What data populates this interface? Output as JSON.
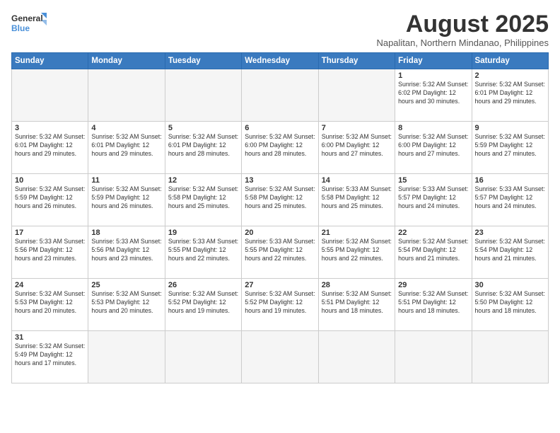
{
  "logo": {
    "line1": "General",
    "line2": "Blue"
  },
  "title": "August 2025",
  "subtitle": "Napalitan, Northern Mindanao, Philippines",
  "weekdays": [
    "Sunday",
    "Monday",
    "Tuesday",
    "Wednesday",
    "Thursday",
    "Friday",
    "Saturday"
  ],
  "weeks": [
    [
      {
        "day": "",
        "info": ""
      },
      {
        "day": "",
        "info": ""
      },
      {
        "day": "",
        "info": ""
      },
      {
        "day": "",
        "info": ""
      },
      {
        "day": "",
        "info": ""
      },
      {
        "day": "1",
        "info": "Sunrise: 5:32 AM\nSunset: 6:02 PM\nDaylight: 12 hours\nand 30 minutes."
      },
      {
        "day": "2",
        "info": "Sunrise: 5:32 AM\nSunset: 6:01 PM\nDaylight: 12 hours\nand 29 minutes."
      }
    ],
    [
      {
        "day": "3",
        "info": "Sunrise: 5:32 AM\nSunset: 6:01 PM\nDaylight: 12 hours\nand 29 minutes."
      },
      {
        "day": "4",
        "info": "Sunrise: 5:32 AM\nSunset: 6:01 PM\nDaylight: 12 hours\nand 29 minutes."
      },
      {
        "day": "5",
        "info": "Sunrise: 5:32 AM\nSunset: 6:01 PM\nDaylight: 12 hours\nand 28 minutes."
      },
      {
        "day": "6",
        "info": "Sunrise: 5:32 AM\nSunset: 6:00 PM\nDaylight: 12 hours\nand 28 minutes."
      },
      {
        "day": "7",
        "info": "Sunrise: 5:32 AM\nSunset: 6:00 PM\nDaylight: 12 hours\nand 27 minutes."
      },
      {
        "day": "8",
        "info": "Sunrise: 5:32 AM\nSunset: 6:00 PM\nDaylight: 12 hours\nand 27 minutes."
      },
      {
        "day": "9",
        "info": "Sunrise: 5:32 AM\nSunset: 5:59 PM\nDaylight: 12 hours\nand 27 minutes."
      }
    ],
    [
      {
        "day": "10",
        "info": "Sunrise: 5:32 AM\nSunset: 5:59 PM\nDaylight: 12 hours\nand 26 minutes."
      },
      {
        "day": "11",
        "info": "Sunrise: 5:32 AM\nSunset: 5:59 PM\nDaylight: 12 hours\nand 26 minutes."
      },
      {
        "day": "12",
        "info": "Sunrise: 5:32 AM\nSunset: 5:58 PM\nDaylight: 12 hours\nand 25 minutes."
      },
      {
        "day": "13",
        "info": "Sunrise: 5:32 AM\nSunset: 5:58 PM\nDaylight: 12 hours\nand 25 minutes."
      },
      {
        "day": "14",
        "info": "Sunrise: 5:33 AM\nSunset: 5:58 PM\nDaylight: 12 hours\nand 25 minutes."
      },
      {
        "day": "15",
        "info": "Sunrise: 5:33 AM\nSunset: 5:57 PM\nDaylight: 12 hours\nand 24 minutes."
      },
      {
        "day": "16",
        "info": "Sunrise: 5:33 AM\nSunset: 5:57 PM\nDaylight: 12 hours\nand 24 minutes."
      }
    ],
    [
      {
        "day": "17",
        "info": "Sunrise: 5:33 AM\nSunset: 5:56 PM\nDaylight: 12 hours\nand 23 minutes."
      },
      {
        "day": "18",
        "info": "Sunrise: 5:33 AM\nSunset: 5:56 PM\nDaylight: 12 hours\nand 23 minutes."
      },
      {
        "day": "19",
        "info": "Sunrise: 5:33 AM\nSunset: 5:55 PM\nDaylight: 12 hours\nand 22 minutes."
      },
      {
        "day": "20",
        "info": "Sunrise: 5:33 AM\nSunset: 5:55 PM\nDaylight: 12 hours\nand 22 minutes."
      },
      {
        "day": "21",
        "info": "Sunrise: 5:32 AM\nSunset: 5:55 PM\nDaylight: 12 hours\nand 22 minutes."
      },
      {
        "day": "22",
        "info": "Sunrise: 5:32 AM\nSunset: 5:54 PM\nDaylight: 12 hours\nand 21 minutes."
      },
      {
        "day": "23",
        "info": "Sunrise: 5:32 AM\nSunset: 5:54 PM\nDaylight: 12 hours\nand 21 minutes."
      }
    ],
    [
      {
        "day": "24",
        "info": "Sunrise: 5:32 AM\nSunset: 5:53 PM\nDaylight: 12 hours\nand 20 minutes."
      },
      {
        "day": "25",
        "info": "Sunrise: 5:32 AM\nSunset: 5:53 PM\nDaylight: 12 hours\nand 20 minutes."
      },
      {
        "day": "26",
        "info": "Sunrise: 5:32 AM\nSunset: 5:52 PM\nDaylight: 12 hours\nand 19 minutes."
      },
      {
        "day": "27",
        "info": "Sunrise: 5:32 AM\nSunset: 5:52 PM\nDaylight: 12 hours\nand 19 minutes."
      },
      {
        "day": "28",
        "info": "Sunrise: 5:32 AM\nSunset: 5:51 PM\nDaylight: 12 hours\nand 18 minutes."
      },
      {
        "day": "29",
        "info": "Sunrise: 5:32 AM\nSunset: 5:51 PM\nDaylight: 12 hours\nand 18 minutes."
      },
      {
        "day": "30",
        "info": "Sunrise: 5:32 AM\nSunset: 5:50 PM\nDaylight: 12 hours\nand 18 minutes."
      }
    ],
    [
      {
        "day": "31",
        "info": "Sunrise: 5:32 AM\nSunset: 5:49 PM\nDaylight: 12 hours\nand 17 minutes."
      },
      {
        "day": "",
        "info": ""
      },
      {
        "day": "",
        "info": ""
      },
      {
        "day": "",
        "info": ""
      },
      {
        "day": "",
        "info": ""
      },
      {
        "day": "",
        "info": ""
      },
      {
        "day": "",
        "info": ""
      }
    ]
  ]
}
